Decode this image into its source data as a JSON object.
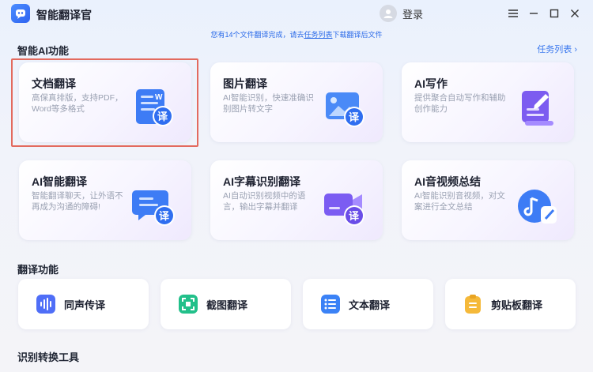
{
  "app": {
    "title": "智能翻译官",
    "login_label": "登录"
  },
  "notice": {
    "prefix": "您有14个文件翻译完成，请去",
    "link": "任务列表",
    "suffix": "下载翻译后文件"
  },
  "sections": {
    "ai": "智能AI功能",
    "task_list": "任务列表 ›",
    "translate": "翻译功能",
    "convert": "识别转换工具"
  },
  "features": [
    {
      "title": "文档翻译",
      "desc": "高保真排版，支持PDF，Word等多格式",
      "icon": "document-translate-icon",
      "badge": "译"
    },
    {
      "title": "图片翻译",
      "desc": "AI智能识别，快速准确识别图片转文字",
      "icon": "image-translate-icon",
      "badge": "译"
    },
    {
      "title": "AI写作",
      "desc": "提供聚合自动写作和辅助创作能力",
      "icon": "ai-writing-icon",
      "badge": ""
    },
    {
      "title": "AI智能翻译",
      "desc": "智能翻译聊天，让外语不再成为沟通的障碍!",
      "icon": "chat-translate-icon",
      "badge": "译"
    },
    {
      "title": "AI字幕识别翻译",
      "desc": "AI自动识别视频中的语言，输出字幕并翻译",
      "icon": "subtitle-translate-icon",
      "badge": "译"
    },
    {
      "title": "AI音视频总结",
      "desc": "AI智能识别音视频，对文案进行全文总结",
      "icon": "audio-video-summary-icon",
      "badge": ""
    }
  ],
  "tools": [
    {
      "label": "同声传译",
      "icon": "voice-wave-icon",
      "color": "#4f6ef7"
    },
    {
      "label": "截图翻译",
      "icon": "screenshot-icon",
      "color": "#22c08a"
    },
    {
      "label": "文本翻译",
      "icon": "text-list-icon",
      "color": "#3b82f6"
    },
    {
      "label": "剪贴板翻译",
      "icon": "clipboard-icon",
      "color": "#f5b93a"
    }
  ]
}
